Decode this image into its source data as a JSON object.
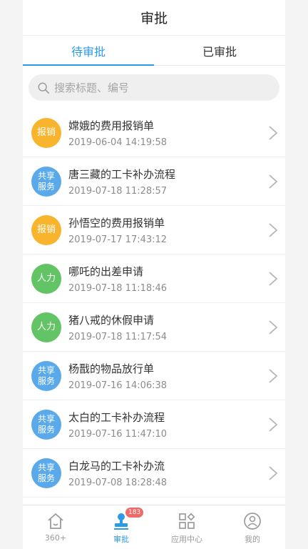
{
  "header": {
    "title": "审批"
  },
  "tabs": [
    {
      "label": "待审批",
      "active": true
    },
    {
      "label": "已审批",
      "active": false
    }
  ],
  "search": {
    "placeholder": "搜索标题、编号"
  },
  "items": [
    {
      "badge": "报销",
      "badge_color": "orange",
      "title": "嫦娥的费用报销单",
      "time": "2019-06-04 14:19:58"
    },
    {
      "badge": "共享服务",
      "badge_color": "blue",
      "title": "唐三藏的工卡补办流程",
      "time": "2019-07-18 11:28:57"
    },
    {
      "badge": "报销",
      "badge_color": "orange",
      "title": "孙悟空的费用报销单",
      "time": "2019-07-17 17:43:12"
    },
    {
      "badge": "人力",
      "badge_color": "green",
      "title": "哪吒的出差申请",
      "time": "2019-07-18 11:18:46"
    },
    {
      "badge": "人力",
      "badge_color": "green",
      "title": "猪八戒的休假申请",
      "time": "2019-07-18 11:17:54"
    },
    {
      "badge": "共享服务",
      "badge_color": "blue",
      "title": "杨戬的物品放行单",
      "time": "2019-07-16 14:06:38"
    },
    {
      "badge": "共享服务",
      "badge_color": "blue",
      "title": "太白的工卡补办流程",
      "time": "2019-07-16 11:47:10"
    },
    {
      "badge": "共享服务",
      "badge_color": "blue",
      "title": "白龙马的工卡补办流",
      "time": "2019-07-08 18:28:48"
    }
  ],
  "tabbar": {
    "home": {
      "label": "360+"
    },
    "approval": {
      "label": "审批",
      "badge": "183"
    },
    "apps": {
      "label": "应用中心"
    },
    "me": {
      "label": "我的"
    }
  },
  "colors": {
    "accent": "#2b9be8",
    "orange": "#f7b42c",
    "blue": "#5aa9ea",
    "green": "#63c466"
  }
}
